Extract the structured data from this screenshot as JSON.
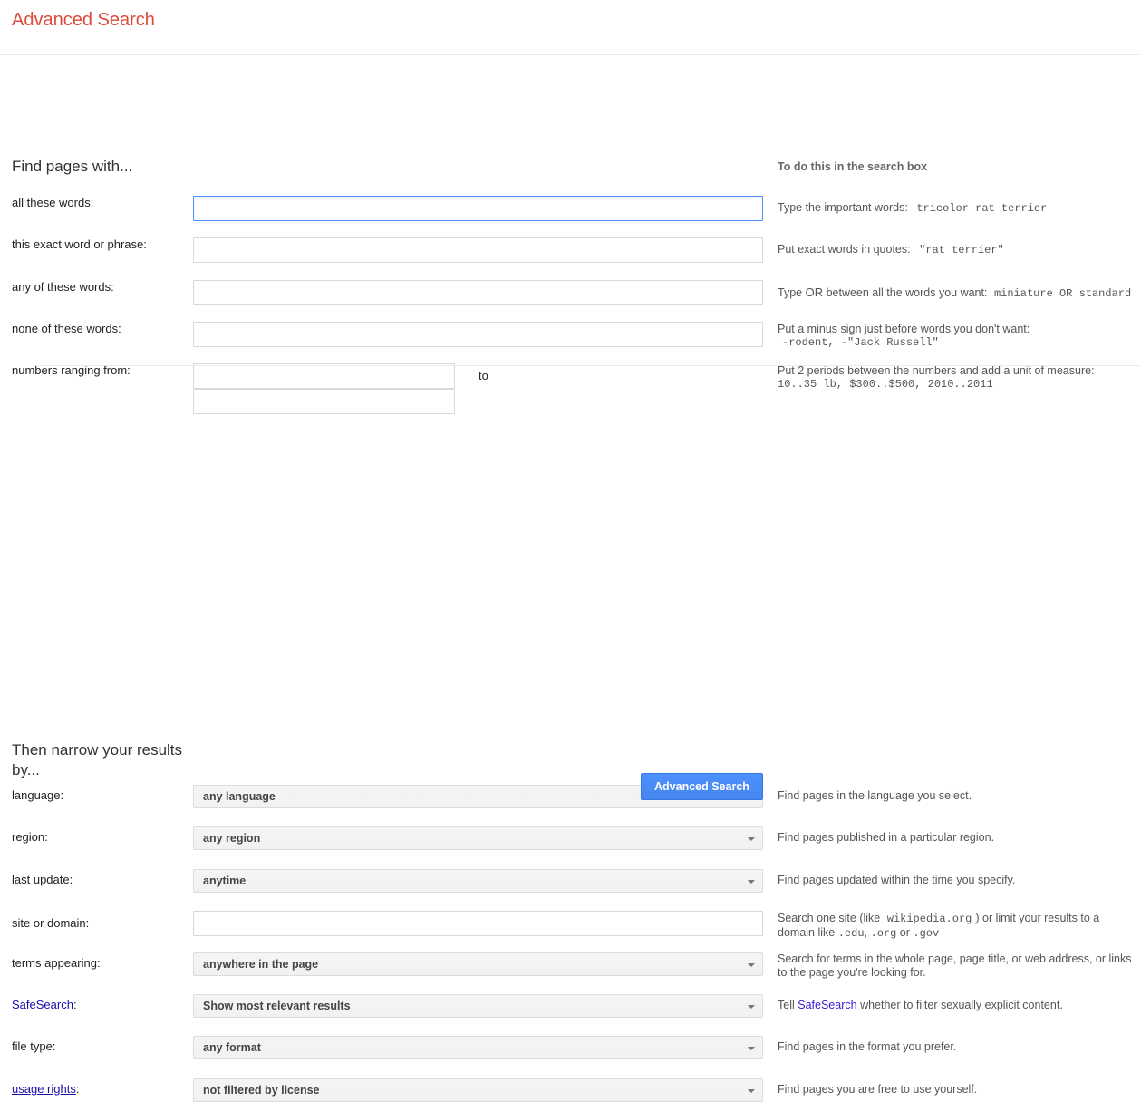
{
  "header": {
    "title": "Advanced Search",
    "title_color": "#dd4b39"
  },
  "sections": {
    "find": {
      "heading": "Find pages with...",
      "help_heading": "To do this in the search box",
      "rows": [
        {
          "label": "all these words:",
          "value": "",
          "focused": true,
          "help_text": "Type the important words:",
          "help_code": "tricolor rat terrier"
        },
        {
          "label": "this exact word or phrase:",
          "value": "",
          "focused": false,
          "help_text": "Put exact words in quotes:",
          "help_code": "\"rat terrier\""
        },
        {
          "label": "any of these words:",
          "value": "",
          "focused": false,
          "help_text_a": "Type",
          "help_or": "OR",
          "help_text_b": "between all the words you want:",
          "help_code": "miniature OR standard"
        },
        {
          "label": "none of these words:",
          "value": "",
          "focused": false,
          "help_text": "Put a minus sign just before words you don't want:",
          "help_code": "-rodent, -\"Jack Russell\""
        },
        {
          "label": "numbers ranging from:",
          "value_from": "",
          "value_to": "",
          "separator": "to",
          "help_text": "Put 2 periods between the numbers and add a unit of measure:",
          "help_code": "10..35 lb, $300..$500, 2010..2011"
        }
      ]
    },
    "narrow": {
      "heading": "Then narrow your results by...",
      "rows": [
        {
          "label": "language:",
          "type": "select",
          "value": "any language",
          "help": "Find pages in the language you select."
        },
        {
          "label": "region:",
          "type": "select",
          "value": "any region",
          "help": "Find pages published in a particular region."
        },
        {
          "label": "last update:",
          "type": "select",
          "value": "anytime",
          "help": "Find pages updated within the time you specify."
        },
        {
          "label": "site or domain:",
          "type": "text",
          "value": "",
          "help_a": "Search one site (like",
          "help_code_1": "wikipedia.org",
          "help_b": ") or limit your results to a domain like",
          "help_code_2": ".edu",
          "help_c": ",",
          "help_code_3": ".org",
          "help_d": "or",
          "help_code_4": ".gov"
        },
        {
          "label": "terms appearing:",
          "type": "select",
          "value": "anywhere in the page",
          "help": "Search for terms in the whole page, page title, or web address, or links to the page you're looking for."
        },
        {
          "label": "SafeSearch:",
          "label_link": "SafeSearch",
          "label_suffix": ":",
          "type": "select",
          "value": "Show most relevant results",
          "help_a": "Tell",
          "help_link": "SafeSearch",
          "help_b": "whether to filter sexually explicit content."
        },
        {
          "label": "file type:",
          "type": "select",
          "value": "any format",
          "help": "Find pages in the format you prefer."
        },
        {
          "label": "usage rights:",
          "label_link": "usage rights",
          "label_suffix": ":",
          "type": "select",
          "value": "not filtered by license",
          "help": "Find pages you are free to use yourself."
        }
      ]
    }
  },
  "submit": {
    "label": "Advanced Search"
  }
}
